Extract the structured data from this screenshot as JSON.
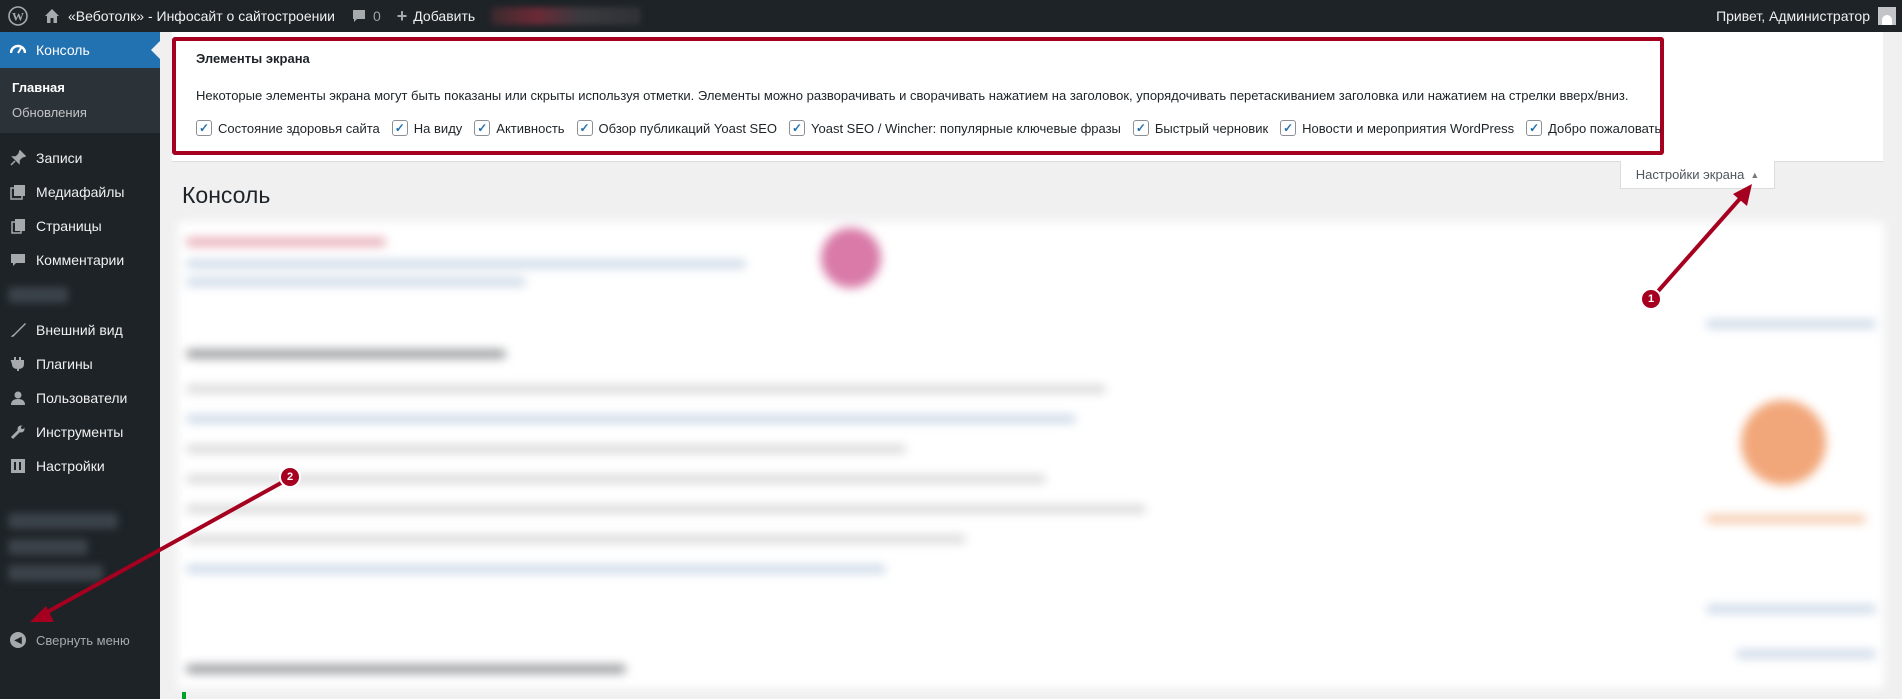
{
  "adminbar": {
    "site_name": "«Веботолк» - Инфосайт о сайтостроении",
    "comments_count": "0",
    "add_label": "Добавить",
    "greeting": "Привет, Администратор"
  },
  "sidebar": {
    "console_label": "Консоль",
    "submenu": [
      {
        "label": "Главная"
      },
      {
        "label": "Обновления"
      }
    ],
    "items": [
      {
        "label": "Записи",
        "icon": "pin-icon"
      },
      {
        "label": "Медиафайлы",
        "icon": "media-icon"
      },
      {
        "label": "Страницы",
        "icon": "pages-icon"
      },
      {
        "label": "Комментарии",
        "icon": "comment-icon"
      },
      {
        "label": "Внешний вид",
        "icon": "appearance-icon"
      },
      {
        "label": "Плагины",
        "icon": "plugins-icon"
      },
      {
        "label": "Пользователи",
        "icon": "users-icon"
      },
      {
        "label": "Инструменты",
        "icon": "tools-icon"
      },
      {
        "label": "Настройки",
        "icon": "settings-icon"
      }
    ],
    "collapse_label": "Свернуть меню"
  },
  "screen_options": {
    "heading": "Элементы экрана",
    "description": "Некоторые элементы экрана могут быть показаны или скрыты используя отметки. Элементы можно разворачивать и сворачивать нажатием на заголовок, упорядочивать перетаскиванием заголовка или нажатием на стрелки вверх/вниз.",
    "options": [
      {
        "label": "Состояние здоровья сайта",
        "checked": true
      },
      {
        "label": "На виду",
        "checked": true
      },
      {
        "label": "Активность",
        "checked": true
      },
      {
        "label": "Обзор публикаций Yoast SEO",
        "checked": true
      },
      {
        "label": "Yoast SEO / Wincher: популярные ключевые фразы",
        "checked": true
      },
      {
        "label": "Быстрый черновик",
        "checked": true
      },
      {
        "label": "Новости и мероприятия WordPress",
        "checked": true
      },
      {
        "label": "Добро пожаловать",
        "checked": true
      }
    ],
    "toggle_label": "Настройки экрана"
  },
  "page": {
    "title": "Консоль"
  },
  "annotations": [
    {
      "label": "1"
    },
    {
      "label": "2"
    }
  ],
  "colors": {
    "adminbar": "#1d2327",
    "accent": "#2271b1",
    "annotation": "#a5001f"
  }
}
